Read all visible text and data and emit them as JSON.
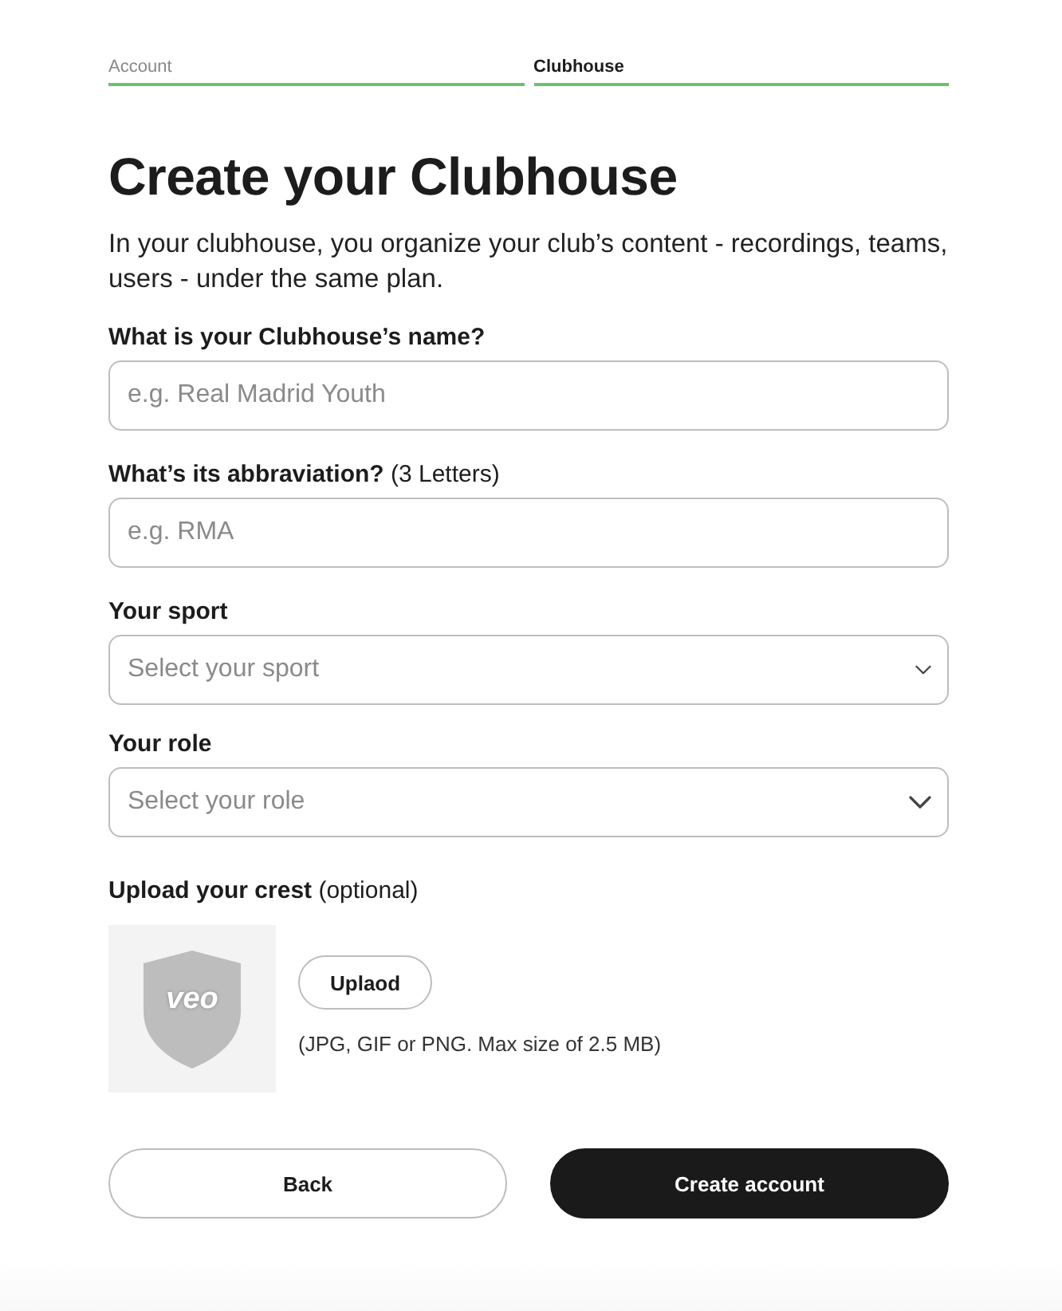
{
  "steps": [
    {
      "label": "Account",
      "selected": false
    },
    {
      "label": "Clubhouse",
      "selected": true
    }
  ],
  "title": "Create your Clubhouse",
  "description": "In your clubhouse, you organize your club’s content - recordings, teams, users - under the same plan.",
  "fields": [
    {
      "kind": "text",
      "label": "What is your Clubhouse’s name?",
      "placeholder": "e.g. Real Madrid Youth"
    },
    {
      "kind": "text",
      "label": "**What’s its abbraviation?** (3 Letters)",
      "placeholder": "e.g. RMA"
    },
    {
      "kind": "select",
      "label": "**Your sport**",
      "placeholder": "Select your sport"
    },
    {
      "kind": "select",
      "label": "**Your role**",
      "placeholder": "Select your role"
    }
  ],
  "upload": {
    "label": "**Upload your crest** (optional)",
    "crest_logo": "veo",
    "button": "Uplaod",
    "hint": "(JPG, GIF or PNG. Max size of 2.5 MB)"
  },
  "actions": [
    {
      "kind": "secondary",
      "label": "Back"
    },
    {
      "kind": "primary",
      "label": "Create account"
    }
  ]
}
